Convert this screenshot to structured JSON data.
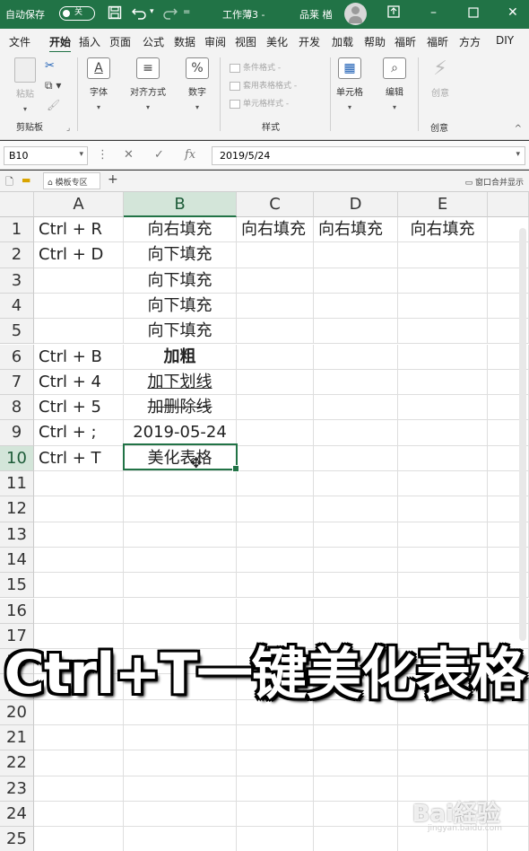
{
  "titlebar": {
    "autosave_label": "自动保存",
    "autosave_state": "关",
    "doc_title": "工作薄3 -",
    "user_name": "品莱 楢",
    "icons": [
      "save-icon",
      "undo-icon",
      "redo-icon",
      "avatar-icon",
      "ribbon-display-icon"
    ]
  },
  "ribbon_tabs": [
    "文件",
    "开始",
    "插入",
    "页面",
    "公式",
    "数据",
    "审阅",
    "视图",
    "美化",
    "开发",
    "加载",
    "帮助",
    "福昕",
    "福昕",
    "方方",
    "DIY"
  ],
  "active_tab": "开始",
  "ribbon": {
    "clipboard": {
      "paste": "粘贴",
      "group": "剪贴板"
    },
    "font": {
      "label": "字体"
    },
    "alignment": {
      "label": "对齐方式"
    },
    "number": {
      "label": "数字"
    },
    "styles": {
      "items": [
        "条件格式 -",
        "套用表格格式 -",
        "单元格样式 -"
      ],
      "group": "样式"
    },
    "cells": {
      "label": "单元格"
    },
    "editing": {
      "label": "编辑"
    },
    "creative": {
      "label": "创意",
      "group": "创意"
    }
  },
  "formula_bar": {
    "name_box": "B10",
    "fx_label": "fx",
    "value": "2019/5/24"
  },
  "toolbar2": {
    "template_area": "模板专区",
    "merge_label": "窗口合并显示"
  },
  "sheet": {
    "columns": [
      "A",
      "B",
      "C",
      "D",
      "E"
    ],
    "selected_column": "B",
    "row_numbers": [
      "1",
      "2",
      "3",
      "4",
      "5",
      "6",
      "7",
      "8",
      "9",
      "10",
      "11",
      "12",
      "13",
      "14",
      "15",
      "16",
      "17",
      "18",
      "19",
      "20",
      "21",
      "22",
      "23",
      "24",
      "25"
    ],
    "selected_row": "10",
    "rows": [
      {
        "a": "Ctrl + R",
        "b": "向右填充",
        "c": "向右填充",
        "d": "向右填充",
        "e": "向右填充",
        "b_style": ""
      },
      {
        "a": "Ctrl + D",
        "b": "向下填充",
        "c": "",
        "d": "",
        "e": "",
        "b_style": ""
      },
      {
        "a": "",
        "b": "向下填充",
        "c": "",
        "d": "",
        "e": "",
        "b_style": ""
      },
      {
        "a": "",
        "b": "向下填充",
        "c": "",
        "d": "",
        "e": "",
        "b_style": ""
      },
      {
        "a": "",
        "b": "向下填充",
        "c": "",
        "d": "",
        "e": "",
        "b_style": ""
      },
      {
        "a": "Ctrl + B",
        "b": "加粗",
        "c": "",
        "d": "",
        "e": "",
        "b_style": "bold"
      },
      {
        "a": "Ctrl + 4",
        "b": "加下划线",
        "c": "",
        "d": "",
        "e": "",
        "b_style": "underline"
      },
      {
        "a": "Ctrl + 5",
        "b": "加删除线",
        "c": "",
        "d": "",
        "e": "",
        "b_style": "strike"
      },
      {
        "a": "Ctrl + ;",
        "b": "2019-05-24",
        "c": "",
        "d": "",
        "e": "",
        "b_style": ""
      },
      {
        "a": "Ctrl + T",
        "b": "美化表格",
        "c": "",
        "d": "",
        "e": "",
        "b_style": ""
      }
    ]
  },
  "caption": "Ctrl+T一键美化表格",
  "watermark": {
    "brand": "Bai経验",
    "url": "jingyan.baidu.com"
  }
}
